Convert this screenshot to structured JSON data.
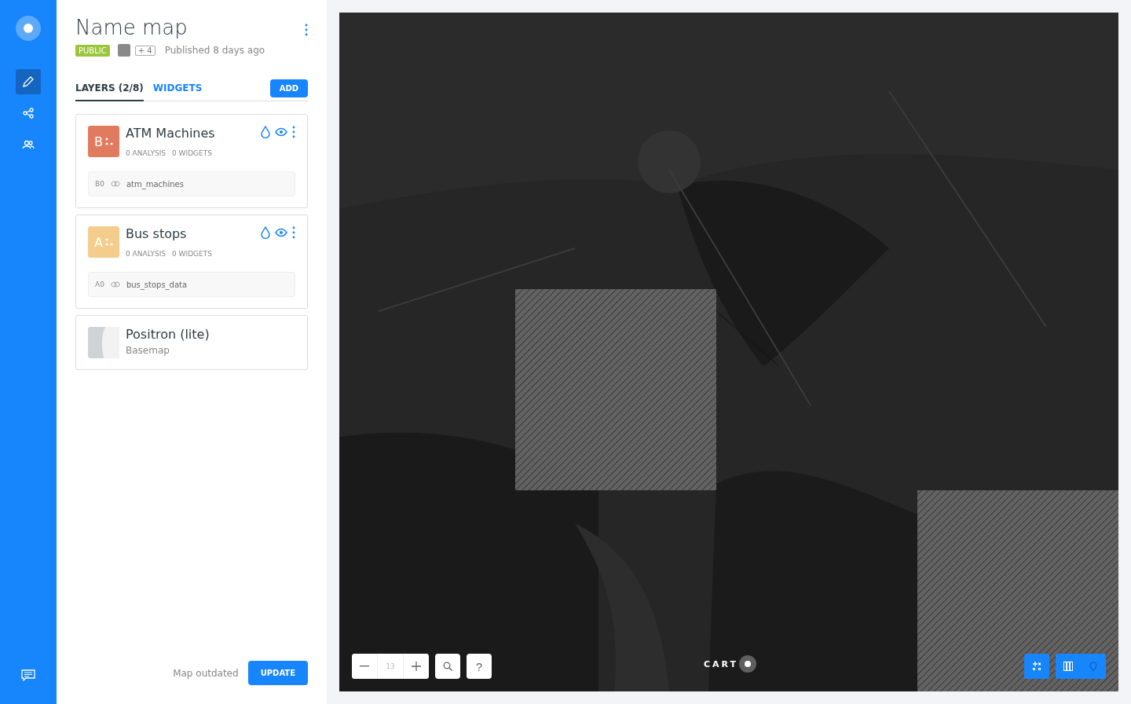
{
  "map_info": {
    "title": "Name map",
    "privacy": "PUBLIC",
    "collaborators_extra": "+ 4",
    "published": "Published 8 days ago"
  },
  "nav": [
    {
      "kind": "pencil",
      "selected": true
    },
    {
      "kind": "share",
      "selected": false
    },
    {
      "kind": "people",
      "selected": false
    }
  ],
  "tabs": [
    {
      "label": "LAYERS (2/8)",
      "selected": true
    },
    {
      "label": "WIDGETS",
      "selected": false
    }
  ],
  "add_button": "ADD",
  "layers": [
    {
      "kind": "data",
      "letter": "B",
      "color": "#e17b5f",
      "name": "ATM Machines",
      "analysis": "0 ANALYSIS",
      "widgets": "0 WIDGETS",
      "source_id": "B0",
      "source": "atm_machines"
    },
    {
      "kind": "data",
      "letter": "A",
      "color": "#f4cd8d",
      "name": "Bus stops",
      "analysis": "0 ANALYSIS",
      "widgets": "0 WIDGETS",
      "source_id": "A0",
      "source": "bus_stops_data"
    },
    {
      "kind": "basemap",
      "name": "Positron (lite)",
      "subtitle": "Basemap"
    }
  ],
  "footer": {
    "status": "Map outdated",
    "button": "UPDATE"
  },
  "map": {
    "zoom": "13",
    "help": "?",
    "logo": "CART"
  }
}
